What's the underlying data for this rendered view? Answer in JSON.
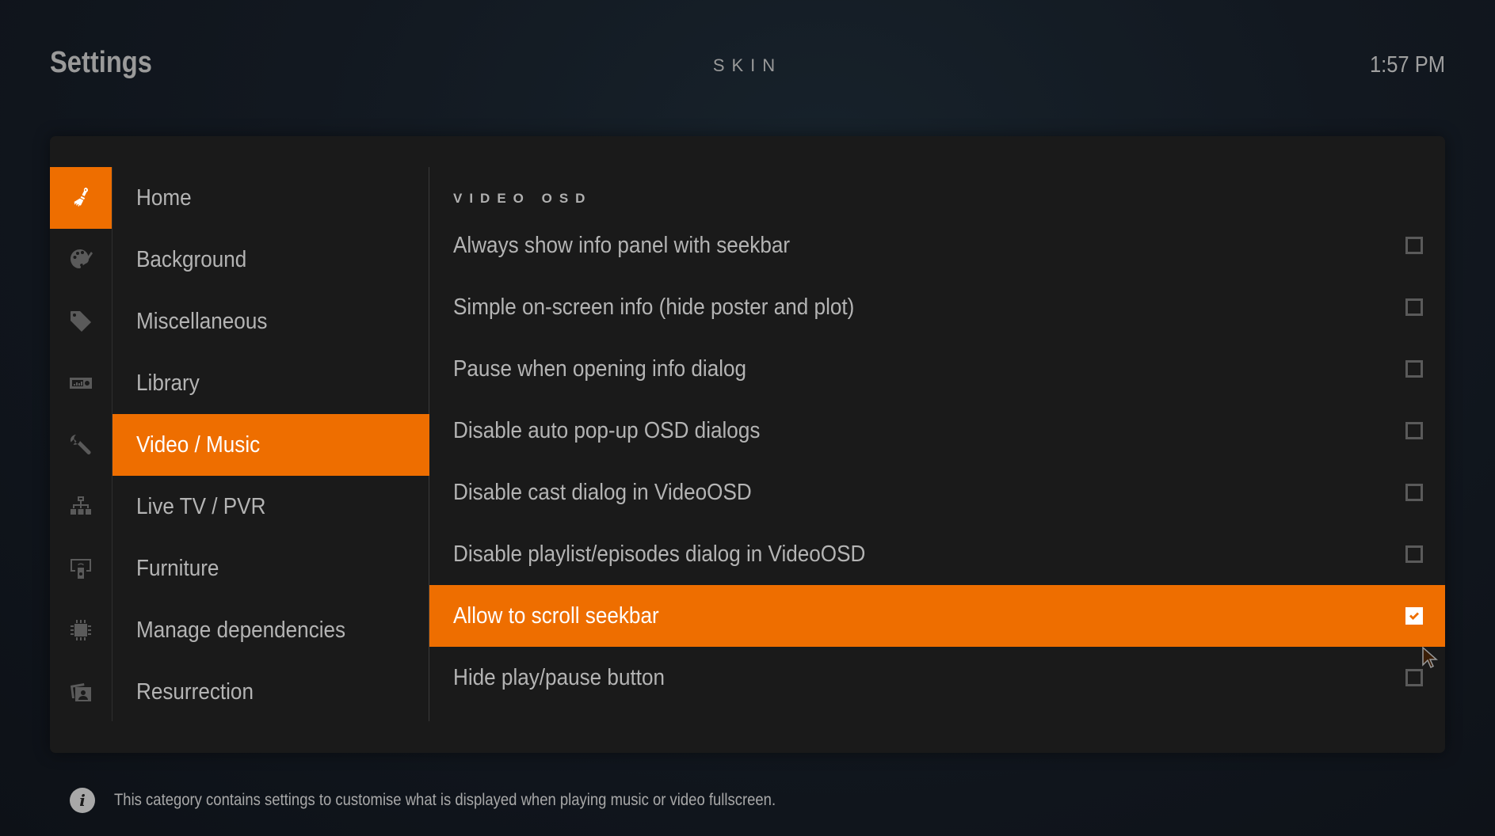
{
  "header": {
    "title": "Settings",
    "section": "SKIN",
    "clock": "1:57 PM"
  },
  "colors": {
    "accent": "#ee6e00",
    "panel_bg": "#1a1a1a",
    "text": "#b4b4b4"
  },
  "categories": [
    {
      "label": "Home",
      "icon": "paint-brush-icon",
      "active_icon": true
    },
    {
      "label": "Background",
      "icon": "palette-icon"
    },
    {
      "label": "Miscellaneous",
      "icon": "tag-icon"
    },
    {
      "label": "Library",
      "icon": "radio-icon"
    },
    {
      "label": "Video / Music",
      "icon": "wrench-icon",
      "selected": true
    },
    {
      "label": "Live TV / PVR",
      "icon": "network-icon"
    },
    {
      "label": "Furniture",
      "icon": "remote-display-icon"
    },
    {
      "label": "Manage dependencies",
      "icon": "cpu-icon"
    },
    {
      "label": "Resurrection",
      "icon": "photos-icon"
    }
  ],
  "settings": {
    "group_header": "VIDEO OSD",
    "items": [
      {
        "label": "Always show info panel with seekbar",
        "checked": false
      },
      {
        "label": "Simple on-screen info (hide poster and plot)",
        "checked": false
      },
      {
        "label": "Pause when opening info dialog",
        "checked": false
      },
      {
        "label": "Disable auto pop-up OSD dialogs",
        "checked": false
      },
      {
        "label": "Disable cast dialog in VideoOSD",
        "checked": false
      },
      {
        "label": "Disable playlist/episodes dialog in VideoOSD",
        "checked": false
      },
      {
        "label": "Allow to scroll seekbar",
        "checked": true,
        "focused": true
      },
      {
        "label": "Hide play/pause button",
        "checked": false
      }
    ]
  },
  "footer": {
    "icon": "info-icon",
    "text": "This category contains settings to customise what is displayed when playing music or video fullscreen."
  }
}
